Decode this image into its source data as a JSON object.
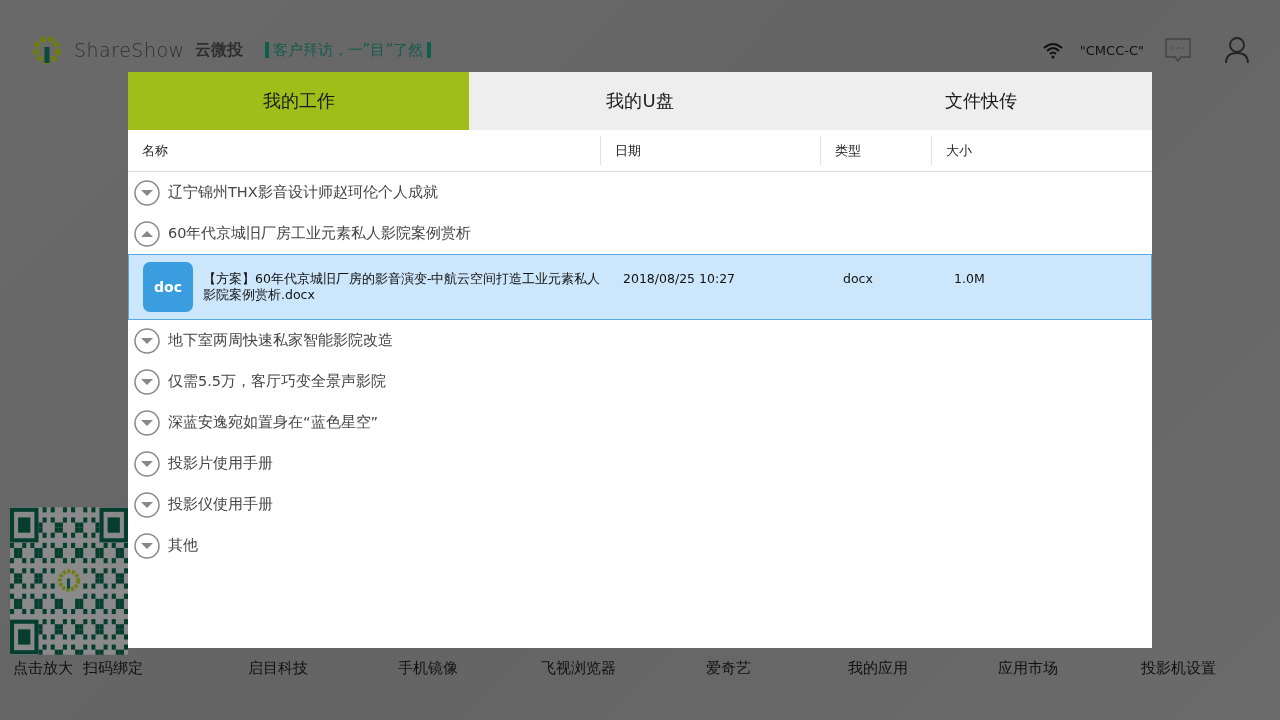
{
  "header": {
    "brand": "ShareShow",
    "product": "云微投",
    "slogan": "客户拜访，一”目“了然",
    "wifi_name": "\"CMCC-C\""
  },
  "dialog": {
    "tabs": [
      {
        "label": "我的工作",
        "selected": true
      },
      {
        "label": "我的U盘",
        "selected": false
      },
      {
        "label": "文件快传",
        "selected": false
      }
    ],
    "columns": [
      "名称",
      "日期",
      "类型",
      "大小"
    ],
    "folders": [
      {
        "name": "辽宁锦州THX影音设计师赵珂伦个人成就",
        "expanded": false
      },
      {
        "name": "60年代京城旧厂房工业元素私人影院案例赏析",
        "expanded": true,
        "children": [
          {
            "icon_label": "doc",
            "name": "【方案】60年代京城旧厂房的影音演变-中航云空间打造工业元素私人影院案例赏析.docx",
            "date": "2018/08/25 10:27",
            "type": "docx",
            "size": "1.0M",
            "selected": true
          }
        ]
      },
      {
        "name": "地下室两周快速私家智能影院改造",
        "expanded": false
      },
      {
        "name": "仅需5.5万，客厅巧变全景声影院",
        "expanded": false
      },
      {
        "name": "深蓝安逸宛如置身在“蓝色星空”",
        "expanded": false
      },
      {
        "name": "投影片使用手册",
        "expanded": false
      },
      {
        "name": "投影仪使用手册",
        "expanded": false
      },
      {
        "name": "其他",
        "expanded": false
      }
    ]
  },
  "qr_caption": "点击放大  扫码绑定",
  "bottom_bar": [
    "启目科技",
    "手机镜像",
    "飞视浏览器",
    "爱奇艺",
    "我的应用",
    "应用市场",
    "投影机设置"
  ]
}
